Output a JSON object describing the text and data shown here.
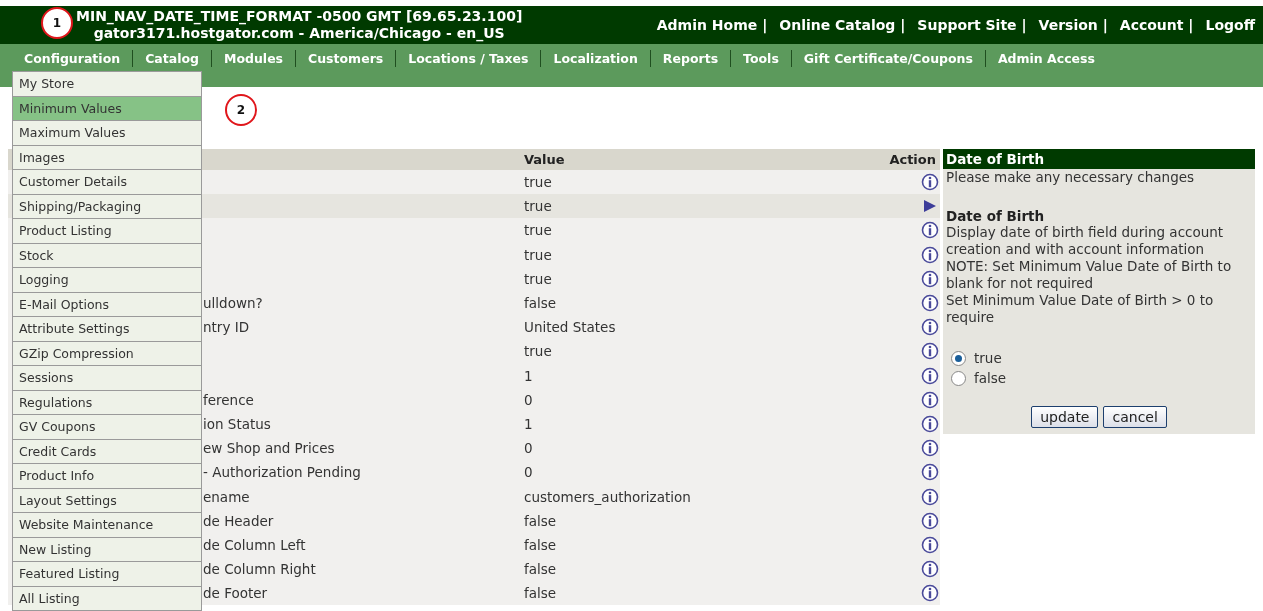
{
  "header": {
    "info_line_1": "MIN_NAV_DATE_TIME_FORMAT -0500 GMT [69.65.23.100]",
    "info_line_2": "gator3171.hostgator.com - America/Chicago - en_US",
    "links": [
      "Admin Home |",
      "Online Catalog |",
      "Support Site |",
      "Version |",
      "Account |",
      "Logoff"
    ]
  },
  "nav": [
    "Configuration",
    "Catalog",
    "Modules",
    "Customers",
    "Locations / Taxes",
    "Localization",
    "Reports",
    "Tools",
    "Gift Certificate/Coupons",
    "Admin Access"
  ],
  "dropdown": [
    {
      "label": "My Store",
      "selected": false
    },
    {
      "label": "Minimum Values",
      "selected": true
    },
    {
      "label": "Maximum Values",
      "selected": false
    },
    {
      "label": "Images",
      "selected": false
    },
    {
      "label": "Customer Details",
      "selected": false
    },
    {
      "label": "Shipping/Packaging",
      "selected": false
    },
    {
      "label": "Product Listing",
      "selected": false
    },
    {
      "label": "Stock",
      "selected": false
    },
    {
      "label": "Logging",
      "selected": false
    },
    {
      "label": "E-Mail Options",
      "selected": false
    },
    {
      "label": "Attribute Settings",
      "selected": false
    },
    {
      "label": "GZip Compression",
      "selected": false
    },
    {
      "label": "Sessions",
      "selected": false
    },
    {
      "label": "Regulations",
      "selected": false
    },
    {
      "label": "GV Coupons",
      "selected": false
    },
    {
      "label": "Credit Cards",
      "selected": false
    },
    {
      "label": "Product Info",
      "selected": false
    },
    {
      "label": "Layout Settings",
      "selected": false
    },
    {
      "label": "Website Maintenance",
      "selected": false
    },
    {
      "label": "New Listing",
      "selected": false
    },
    {
      "label": "Featured Listing",
      "selected": false
    },
    {
      "label": "All Listing",
      "selected": false
    }
  ],
  "table": {
    "columns": [
      "Value",
      "Action"
    ],
    "rows": [
      {
        "title": "",
        "value": "true",
        "selected": false
      },
      {
        "title": "",
        "value": "true",
        "selected": true
      },
      {
        "title": "",
        "value": "true",
        "selected": false
      },
      {
        "title": "",
        "value": "true",
        "selected": false
      },
      {
        "title": "",
        "value": "true",
        "selected": false
      },
      {
        "title": "ulldown?",
        "value": "false",
        "selected": false
      },
      {
        "title": "ntry ID",
        "value": "United States",
        "selected": false
      },
      {
        "title": "",
        "value": "true",
        "selected": false
      },
      {
        "title": "",
        "value": "1",
        "selected": false
      },
      {
        "title": "ference",
        "value": "0",
        "selected": false
      },
      {
        "title": "ion Status",
        "value": "1",
        "selected": false
      },
      {
        "title": "ew Shop and Prices",
        "value": "0",
        "selected": false
      },
      {
        "title": "- Authorization Pending",
        "value": "0",
        "selected": false
      },
      {
        "title": "ename",
        "value": "customers_authorization",
        "selected": false
      },
      {
        "title": "de Header",
        "value": "false",
        "selected": false
      },
      {
        "title": "de Column Left",
        "value": "false",
        "selected": false
      },
      {
        "title": "de Column Right",
        "value": "false",
        "selected": false
      },
      {
        "title": "de Footer",
        "value": "false",
        "selected": false
      }
    ]
  },
  "panel": {
    "title": "Date of Birth",
    "intro": "Please make any necessary changes",
    "heading": "Date of Birth",
    "description": [
      "Display date of birth field during account creation and with account information",
      "NOTE: Set Minimum Value Date of Birth to blank for not required",
      "Set Minimum Value Date of Birth > 0 to require"
    ],
    "options": [
      {
        "label": "true",
        "selected": true
      },
      {
        "label": "false",
        "selected": false
      }
    ],
    "buttons": [
      "update",
      "cancel"
    ]
  },
  "annotations": [
    "1",
    "2"
  ]
}
